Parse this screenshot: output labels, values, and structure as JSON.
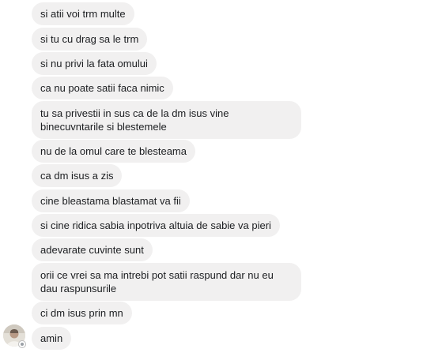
{
  "messages": [
    {
      "text": "si atii voi trm multe"
    },
    {
      "text": "si tu cu drag sa le trm"
    },
    {
      "text": "si nu privi la fata omului"
    },
    {
      "text": "ca nu poate satii faca nimic"
    },
    {
      "text": "tu sa privestii in sus ca de la dm isus vine binecuvntarile si blestemele"
    },
    {
      "text": "nu de la omul care te blesteama"
    },
    {
      "text": "ca dm isus a zis"
    },
    {
      "text": "cine bleastama blastamat va fii"
    },
    {
      "text": "si cine ridica  sabia inpotriva altuia de sabie va pieri"
    },
    {
      "text": "adevarate cuvinte sunt"
    },
    {
      "text": "orii ce vrei sa ma intrebi pot satii raspund dar nu eu dau raspunsurile"
    },
    {
      "text": "ci dm isus prin mn"
    },
    {
      "text": "amin"
    }
  ],
  "colors": {
    "bubble_bg": "#f1f0f0",
    "text": "#1c1e21",
    "page_bg": "#ffffff"
  },
  "icons": {
    "avatar": "user-avatar",
    "badge": "active-status-icon"
  }
}
